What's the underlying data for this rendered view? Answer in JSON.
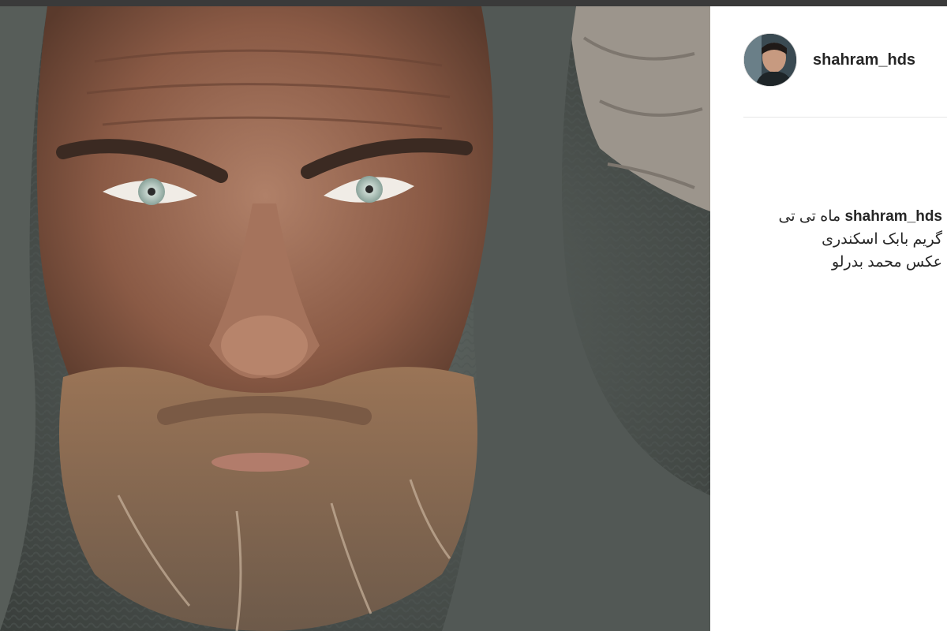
{
  "post": {
    "username": "shahram_hds",
    "image_alt": "portrait of a bearded man in a gray knitted hood",
    "caption": {
      "author": "shahram_hds",
      "lines": [
        "ماه تی تی",
        "گریم بابک اسکندری",
        "عکس محمد بدرلو"
      ]
    }
  },
  "icons": {
    "avatar": "profile-picture"
  },
  "colors": {
    "text": "#262626",
    "divider": "#e6e6e6",
    "background": "#ffffff"
  }
}
